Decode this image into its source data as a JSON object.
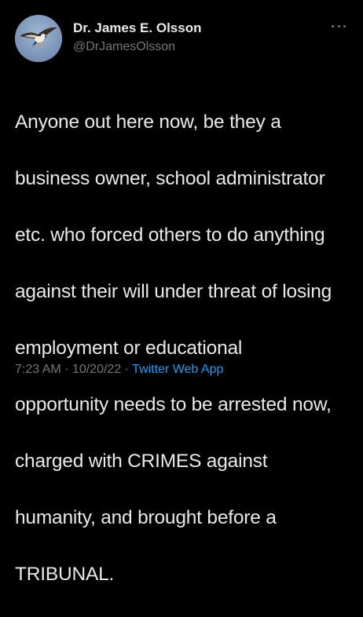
{
  "author": {
    "name": "Dr. James E. Olsson",
    "handle": "@DrJamesOlsson",
    "avatar_icon": "osprey-bird-avatar"
  },
  "tweet": {
    "lines": [
      "Anyone out here now, be they a",
      "business owner, school administrator",
      "etc. who forced others to do anything",
      "against their will under threat of losing",
      "employment or educational",
      "opportunity needs to be arrested now,",
      "charged with CRIMES against",
      "humanity, and brought before a",
      "TRIBUNAL."
    ]
  },
  "meta": {
    "time": "7:23 AM",
    "separator1": " · ",
    "date": "10/20/22",
    "separator2": " · ",
    "app": "Twitter Web App"
  },
  "colors": {
    "background": "#000000",
    "text": "#e7e9ea",
    "muted": "#71767b",
    "link": "#1d9bf0"
  },
  "menu": {
    "icon": "more-options-icon"
  }
}
